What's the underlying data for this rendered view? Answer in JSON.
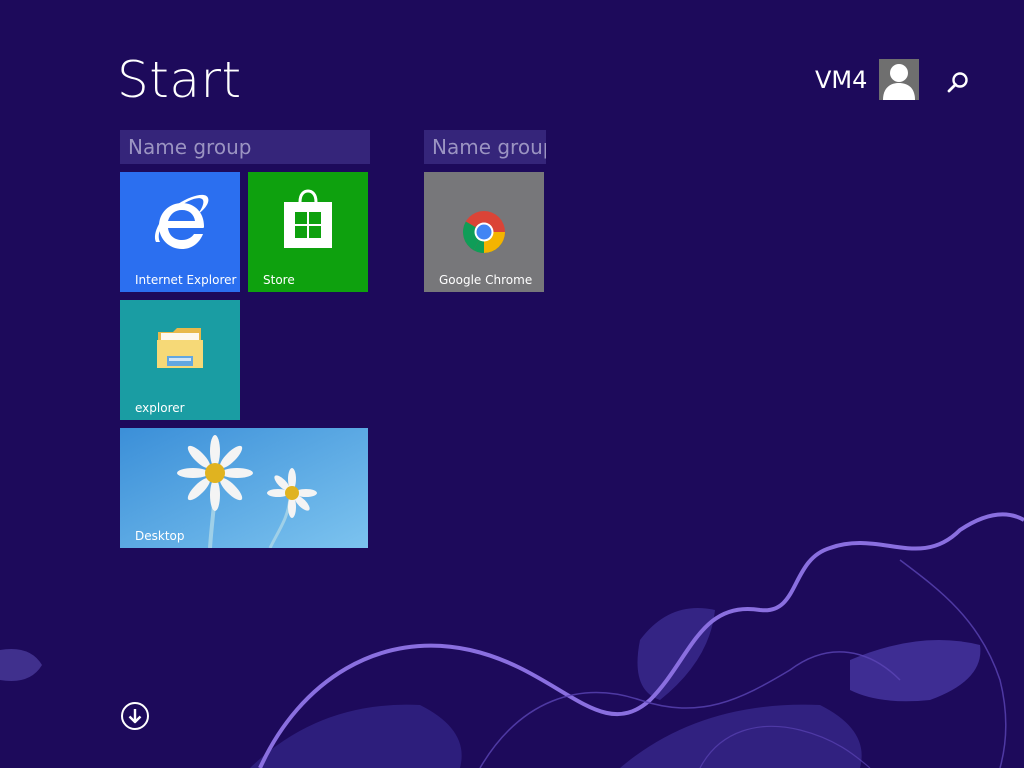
{
  "header": {
    "title": "Start",
    "user_name": "VM4",
    "avatar_icon": "user-silhouette-icon",
    "search_icon": "magnifier-icon"
  },
  "groups": [
    {
      "name": "Name group",
      "tiles": [
        {
          "label": "Internet Explorer",
          "icon": "internet-explorer-icon",
          "color": "#2b6ff0"
        },
        {
          "label": "Store",
          "icon": "store-bag-icon",
          "color": "#0ea10e"
        },
        {
          "label": "explorer",
          "icon": "file-explorer-folder-icon",
          "color": "#1a9da3"
        },
        {
          "label": "Desktop",
          "icon": "desktop-daisy-wallpaper",
          "color": "#4aa3e0"
        }
      ]
    },
    {
      "name": "Name group",
      "tiles": [
        {
          "label": "Google Chrome",
          "icon": "chrome-icon",
          "color": "#77777a"
        }
      ]
    }
  ],
  "footer": {
    "all_apps_icon": "down-arrow-circle-icon"
  },
  "colors": {
    "background": "#1d0a5b",
    "group_header": "#35257a",
    "accent_swirl": "#8a6fe0"
  }
}
